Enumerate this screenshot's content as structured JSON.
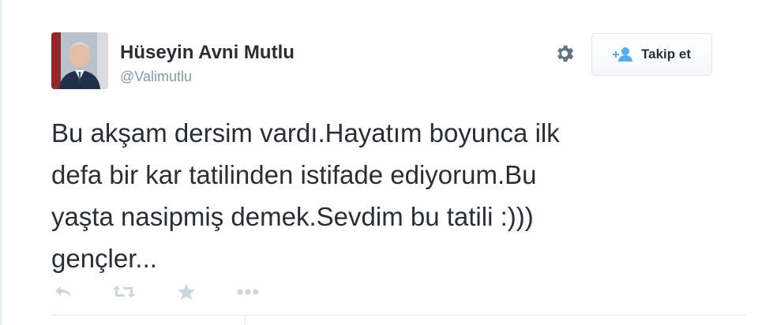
{
  "user": {
    "name": "Hüseyin Avni Mutlu",
    "handle": "@Valimutlu"
  },
  "follow_button": {
    "label": "Takip et",
    "icon": "add-user-icon"
  },
  "settings_icon": "gear-icon",
  "tweet": {
    "lines": [
      "Bu akşam dersim vardı.Hayatım boyunca ilk",
      "defa bir kar tatilinden istifade ediyorum.Bu",
      "yaşta nasipmiş demek.Sevdim bu tatili :)))",
      "gençler..."
    ]
  },
  "actions": [
    {
      "name": "reply",
      "icon": "reply-icon"
    },
    {
      "name": "retweet",
      "icon": "retweet-icon"
    },
    {
      "name": "favorite",
      "icon": "star-icon"
    },
    {
      "name": "more",
      "icon": "more-icon"
    }
  ],
  "colors": {
    "text": "#292f33",
    "muted": "#8899a6",
    "action_icon": "#ccd6dd",
    "gear": "#66757f",
    "follow_icon": "#55acee"
  }
}
